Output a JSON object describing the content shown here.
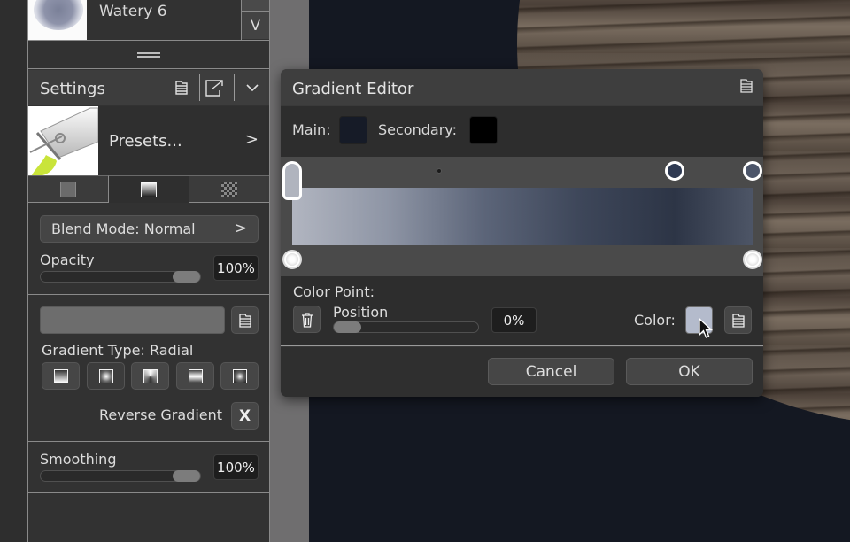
{
  "brush": {
    "name": "Watery 6",
    "scroll_down_glyph": "V"
  },
  "settings": {
    "title": "Settings",
    "icons": [
      "menu-icon",
      "export-icon",
      "collapse-chevron-icon"
    ],
    "presets_label": "Presets...",
    "presets_chevron": ">",
    "tabs": [
      {
        "name": "solid-color",
        "icon": "solid-square-icon",
        "active": false
      },
      {
        "name": "gradient",
        "icon": "gradient-square-icon",
        "active": true
      },
      {
        "name": "pattern",
        "icon": "checkerboard-icon",
        "active": false
      }
    ],
    "blend_mode_label": "Blend Mode: Normal",
    "blend_mode_chevron": ">",
    "opacity": {
      "label": "Opacity",
      "value": "100%",
      "fraction": 1.0
    },
    "gradient_type_label": "Gradient Type: Radial",
    "gradient_types": [
      {
        "name": "linear",
        "selected": false
      },
      {
        "name": "radial",
        "selected": true
      },
      {
        "name": "conical",
        "selected": false
      },
      {
        "name": "mirrored",
        "selected": false
      },
      {
        "name": "diamond",
        "selected": false
      }
    ],
    "reverse_gradient_label": "Reverse Gradient",
    "reverse_gradient_button": "X",
    "smoothing": {
      "label": "Smoothing",
      "value": "100%",
      "fraction": 1.0
    }
  },
  "gradient_editor": {
    "title": "Gradient Editor",
    "main_label": "Main:",
    "main_color": "#161b27",
    "secondary_label": "Secondary:",
    "secondary_color": "#000000",
    "gradient_colors": [
      "#b1b5c0",
      "#8e95a5",
      "#5c6579",
      "#3e475a",
      "#2d3546",
      "#4d5566"
    ],
    "color_stops": [
      {
        "position": 0,
        "color": "#b0b4be",
        "selected": true
      },
      {
        "position": 0.83,
        "color": "#2f3a52",
        "selected": false
      },
      {
        "position": 1.0,
        "color": "#4c5569",
        "selected": false
      }
    ],
    "midpoint_position": 0.32,
    "opacity_stops": [
      0,
      1.0
    ],
    "color_point_label": "Color Point:",
    "position_label": "Position",
    "position_value": "0%",
    "position_fraction": 0.0,
    "color_label": "Color:",
    "selected_color": "#b4bbcc",
    "cancel_label": "Cancel",
    "ok_label": "OK"
  }
}
